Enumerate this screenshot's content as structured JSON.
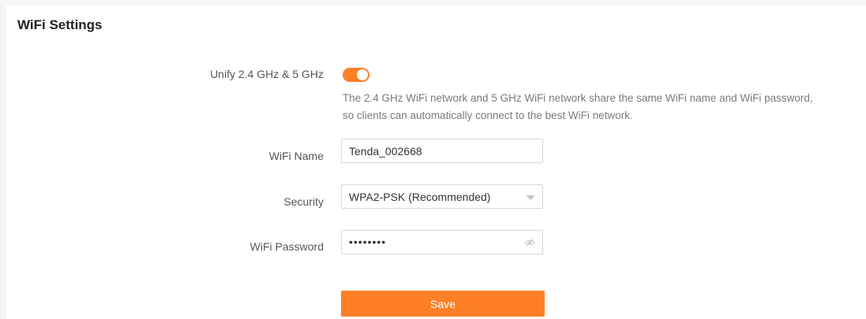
{
  "page_title": "WiFi Settings",
  "unify": {
    "label": "Unify 2.4 GHz & 5 GHz",
    "enabled": true,
    "description_line1": "The 2.4 GHz WiFi network and 5 GHz WiFi network share the same WiFi name and WiFi password,",
    "description_line2": "so clients can automatically connect to the best WiFi network."
  },
  "wifi_name": {
    "label": "WiFi Name",
    "value": "Tenda_002668"
  },
  "security": {
    "label": "Security",
    "value": "WPA2-PSK (Recommended)",
    "icon": "chevron-down-icon"
  },
  "wifi_password": {
    "label": "WiFi Password",
    "value": "••••••••",
    "icon": "eye-off-icon"
  },
  "save_label": "Save",
  "colors": {
    "accent": "#ff7f26"
  }
}
